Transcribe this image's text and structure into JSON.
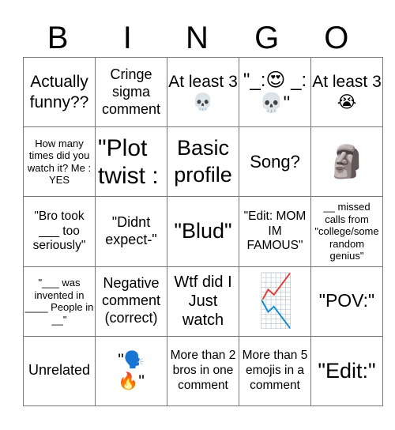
{
  "header": {
    "letters": [
      "B",
      "I",
      "N",
      "G",
      "O"
    ]
  },
  "board": {
    "rows": [
      [
        {
          "text": "Actually funny??",
          "icon": null
        },
        {
          "text": "Cringe sigma comment",
          "icon": null
        },
        {
          "text": "At least 3 💀",
          "icon": "skull-emoji"
        },
        {
          "text": "\"_:😍 _:💀\"",
          "icon": "heart-eyes-and-skull-emoji"
        },
        {
          "text": "At least 3 😭",
          "icon": "loudly-crying-emoji"
        }
      ],
      [
        {
          "text": "How many times did you watch it? Me : YES",
          "icon": null
        },
        {
          "text": "\"Plot twist :",
          "icon": null
        },
        {
          "text": "Basic profile",
          "icon": null
        },
        {
          "text": "Song?",
          "icon": null
        },
        {
          "text": "🗿",
          "icon": "moai-emoji"
        }
      ],
      [
        {
          "text": "\"Bro took ___ too seriously\"",
          "icon": null
        },
        {
          "text": "\"Didnt expect-\"",
          "icon": null
        },
        {
          "text": "\"Blud\"",
          "icon": null
        },
        {
          "text": "\"Edit: MOM IM FAMOUS\"",
          "icon": null
        },
        {
          "text": "__ missed calls from \"college/some random genius\"",
          "icon": null
        }
      ],
      [
        {
          "text": "\"___ was invented in ____ People in __\"",
          "icon": null
        },
        {
          "text": "Negative comment (correct)",
          "icon": null
        },
        {
          "text": "Wtf did I Just watch",
          "icon": null
        },
        {
          "text": "📈📉",
          "icon": "chart-increasing-decreasing-emoji"
        },
        {
          "text": "\"POV:\"",
          "icon": null
        }
      ],
      [
        {
          "text": "Unrelated",
          "icon": null
        },
        {
          "text": "\"🗣️🔥\"",
          "icon": "speaking-head-fire-emoji"
        },
        {
          "text": "More than 2 bros in one comment",
          "icon": null
        },
        {
          "text": "More than 5 emojis in a comment",
          "icon": null
        },
        {
          "text": "\"Edit:\"",
          "icon": null
        }
      ]
    ]
  }
}
